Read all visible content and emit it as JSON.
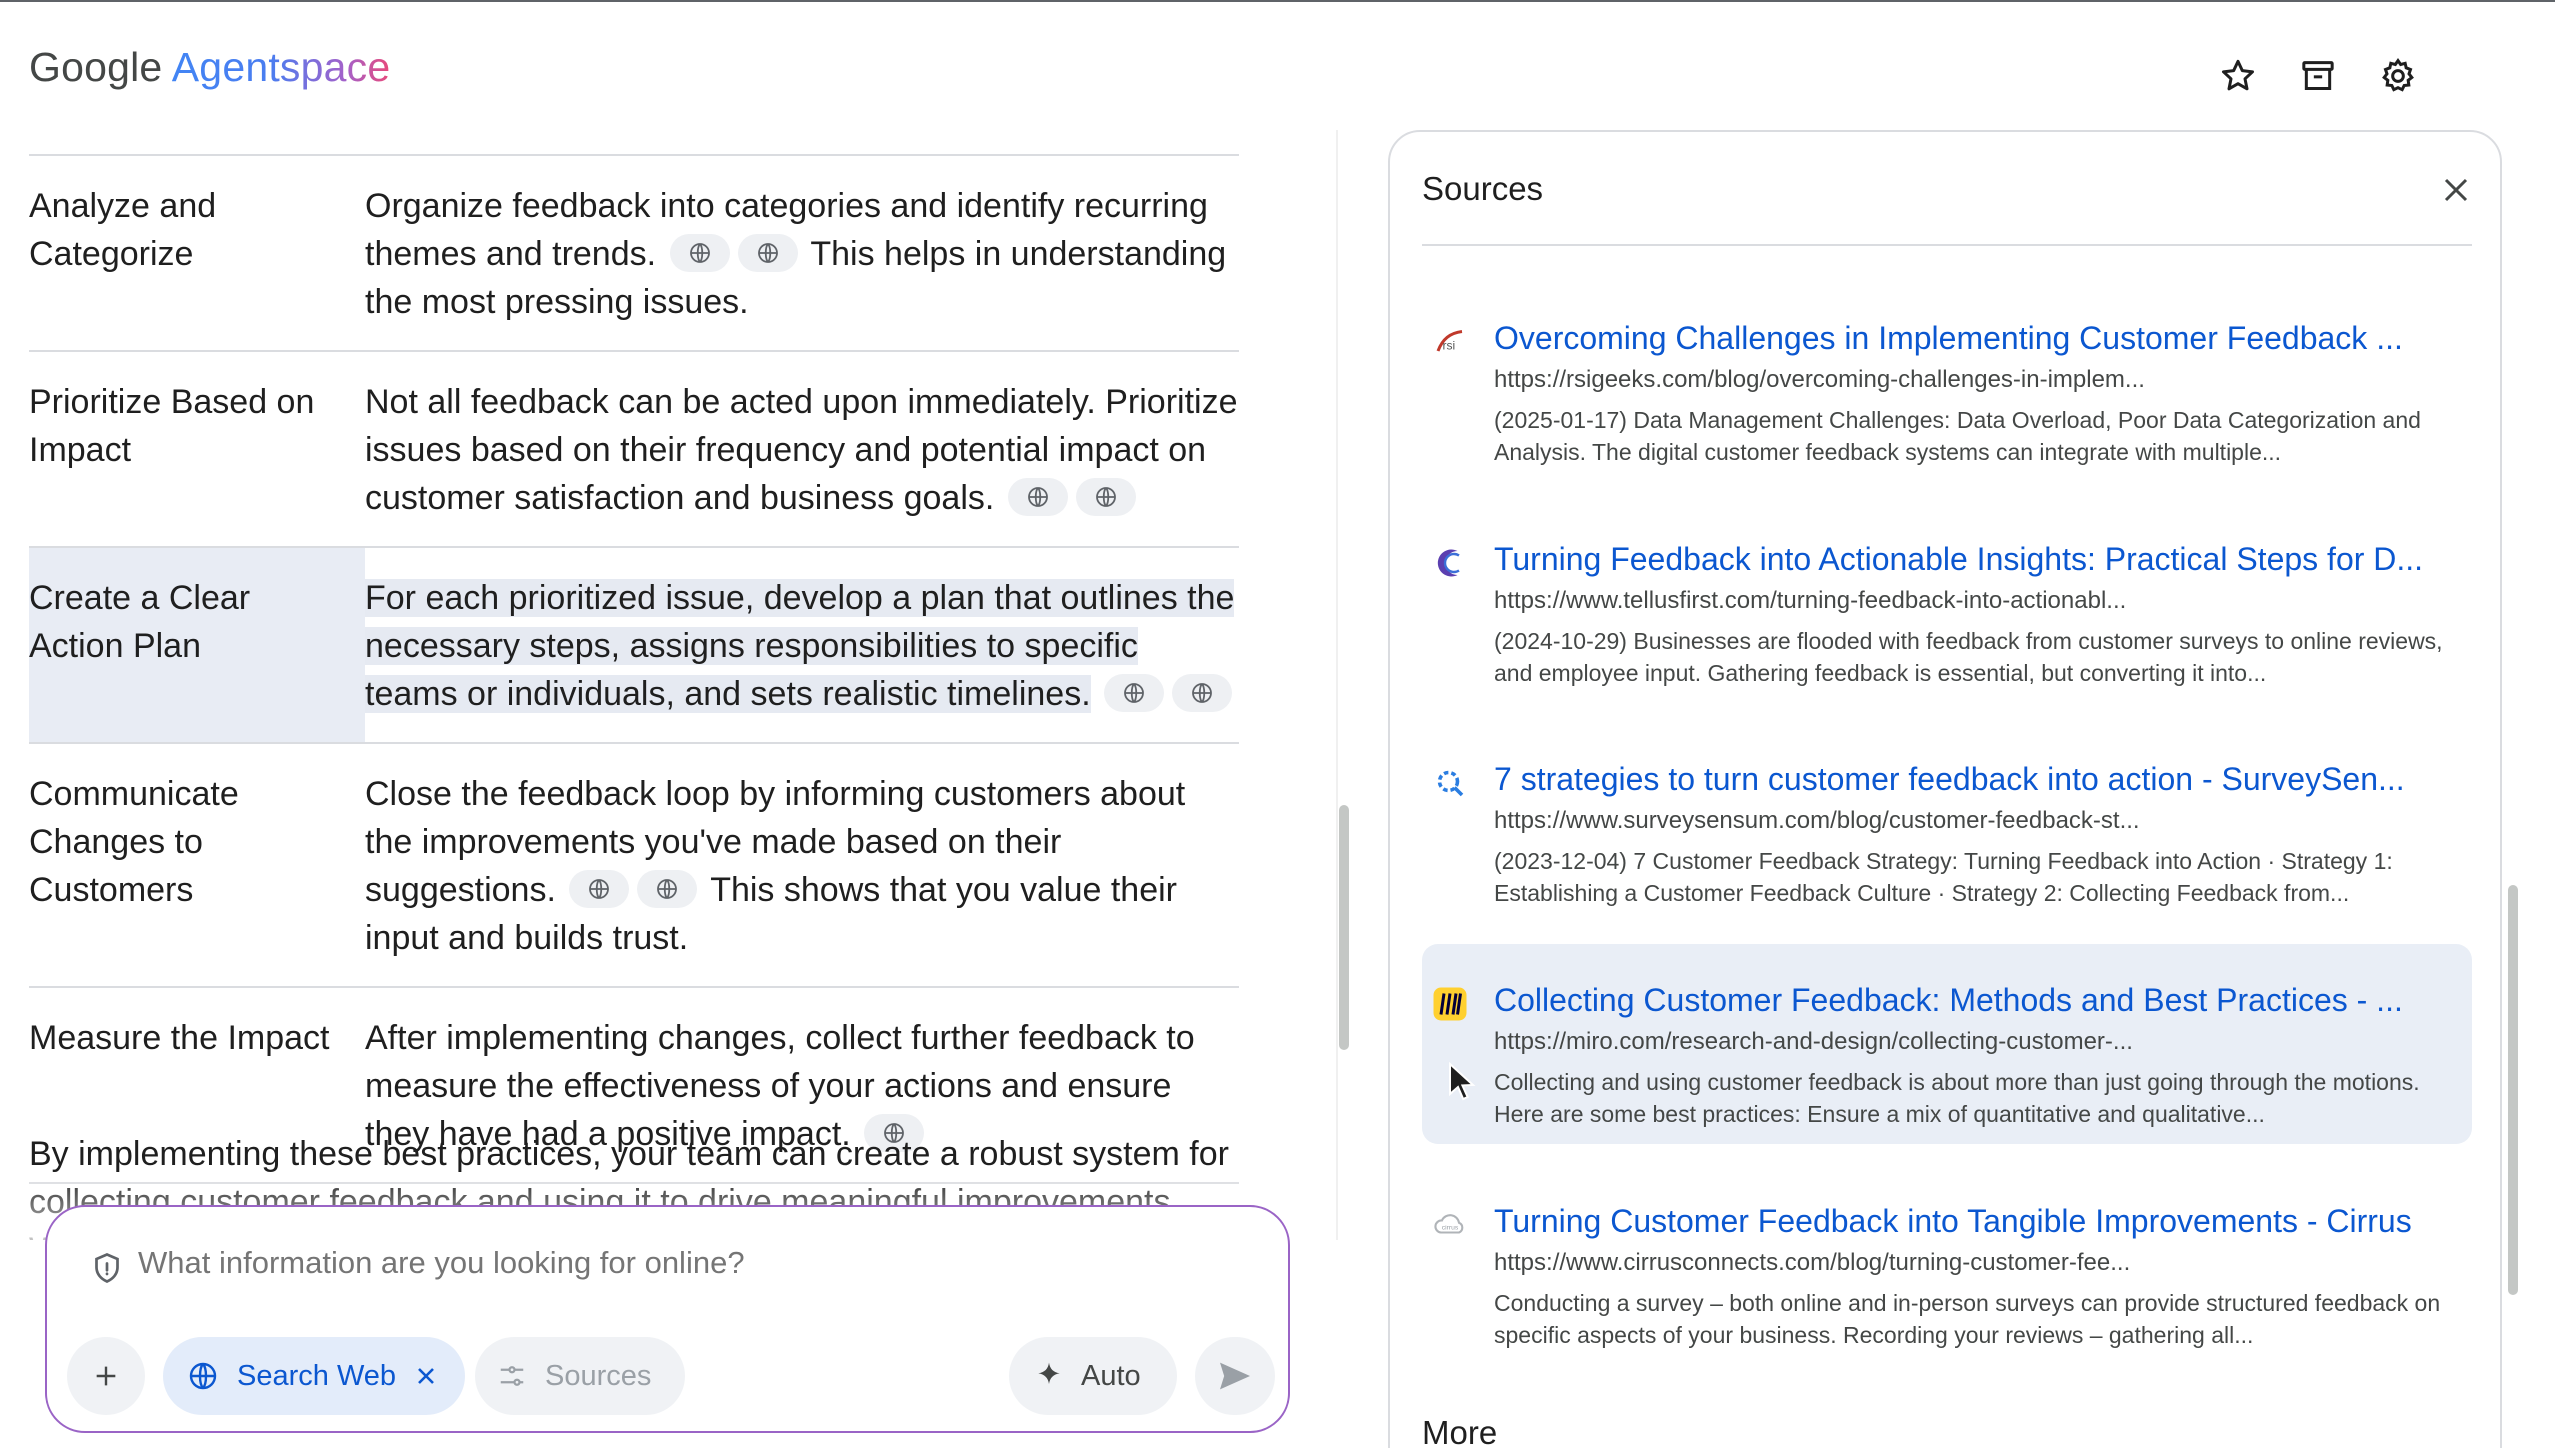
{
  "header": {
    "logo_brand": "Google",
    "logo_product": "Agentspace",
    "icons": [
      "star-icon",
      "archive-icon",
      "gear-icon"
    ]
  },
  "table": {
    "rows": [
      {
        "key": "Analyze and Categorize",
        "pre": "Organize feedback into categories and identify recurring themes and trends.",
        "cites_mid": 2,
        "post": "This helps in understanding the most pressing issues.",
        "cites_end": 0
      },
      {
        "key": "Prioritize Based on Impact",
        "pre": "Not all feedback can be acted upon immediately. Prioritize issues based on their frequency and potential impact on customer satisfaction and business goals.",
        "cites_mid": 2,
        "post": "",
        "cites_end": 0
      },
      {
        "key": "Create a Clear Action Plan",
        "pre": "For each prioritized issue, develop a plan that outlines the necessary steps, assigns responsibilities to specific teams or individuals, and sets realistic timelines.",
        "cites_mid": 2,
        "post": "",
        "cites_end": 0
      },
      {
        "key": "Communicate Changes to Customers",
        "pre": "Close the feedback loop by informing customers about the improvements you've made based on their suggestions.",
        "cites_mid": 2,
        "post": "This shows that you value their input and builds trust.",
        "cites_end": 0
      },
      {
        "key": "Measure the Impact",
        "pre": "After implementing changes, collect further feedback to measure the effectiveness of your actions and ensure they have had a positive impact.",
        "cites_mid": 1,
        "post": "",
        "cites_end": 0
      }
    ]
  },
  "summary": "By implementing these best practices, your team can create a robust system for collecting customer feedback and using it to drive meaningful improvements. Would",
  "composer": {
    "placeholder": "What information are you looking for online?",
    "search_web_label": "Search Web",
    "sources_label": "Sources",
    "auto_label": "Auto"
  },
  "sources_panel": {
    "title": "Sources",
    "items": [
      {
        "title": "Overcoming Challenges in Implementing Customer Feedback ...",
        "url": "https://rsigeeks.com/blog/overcoming-challenges-in-implem...",
        "snippet": "(2025-01-17) Data Management Challenges: Data Overload, Poor Data Categorization and Analysis. The digital customer feedback systems can integrate with multiple...",
        "favicon": "rsi-icon",
        "color": "#c0392b"
      },
      {
        "title": "Turning Feedback into Actionable Insights: Practical Steps for D...",
        "url": "https://www.tellusfirst.com/turning-feedback-into-actionabl...",
        "snippet": "(2024-10-29) Businesses are flooded with feedback from customer surveys to online reviews, and employee input. Gathering feedback is essential, but converting it into...",
        "favicon": "tellus-icon",
        "color": "#5b3fb0"
      },
      {
        "title": "7 strategies to turn customer feedback into action - SurveySen...",
        "url": "https://www.surveysensum.com/blog/customer-feedback-st...",
        "snippet": "(2023-12-04) 7 Customer Feedback Strategy: Turning Feedback into Action · Strategy 1: Establishing a Customer Feedback Culture · Strategy 2: Collecting Feedback from...",
        "favicon": "surveysensum-icon",
        "color": "#2a7de1"
      },
      {
        "title": "Collecting Customer Feedback: Methods and Best Practices - ...",
        "url": "https://miro.com/research-and-design/collecting-customer-...",
        "snippet": "Collecting and using customer feedback is about more than just going through the motions. Here are some best practices: Ensure a mix of quantitative and qualitative...",
        "favicon": "miro-icon",
        "color": "#ffd02f"
      },
      {
        "title": "Turning Customer Feedback into Tangible Improvements - Cirrus",
        "url": "https://www.cirrusconnects.com/blog/turning-customer-fee...",
        "snippet": "Conducting a survey – both online and in-person surveys can provide structured feedback on specific aspects of your business. Recording your reviews – gathering all...",
        "favicon": "cirrus-icon",
        "color": "#9aa0a6"
      }
    ],
    "more_label": "More"
  },
  "colors": {
    "link": "#0b57d0",
    "composer_border": "#9a64c6",
    "highlight": "#e9eef6"
  }
}
